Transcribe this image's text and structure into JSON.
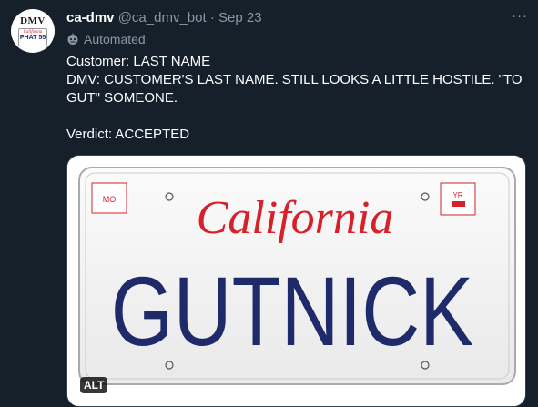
{
  "tweet": {
    "display_name": "ca-dmv",
    "handle": "@ca_dmv_bot",
    "separator": "·",
    "date": "Sep 23",
    "more_label": "···",
    "automated_label": "Automated",
    "lines": [
      "Customer: LAST NAME",
      "DMV: CUSTOMER'S LAST NAME. STILL LOOKS A LITTLE HOSTILE. \"TO GUT\" SOMEONE.",
      "Verdict: ACCEPTED"
    ]
  },
  "avatar": {
    "dmv_text": "DMV",
    "plate_text": "PHAT 55",
    "state_text": "California"
  },
  "plate": {
    "state": "California",
    "number": "GUTNICK",
    "month_sticker": "MO",
    "year_sticker": "YR"
  },
  "media": {
    "alt_badge": "ALT"
  },
  "colors": {
    "background": "#15202b",
    "secondary_text": "#8b98a5",
    "plate_red": "#d7212a",
    "plate_blue": "#1f2a6a"
  }
}
